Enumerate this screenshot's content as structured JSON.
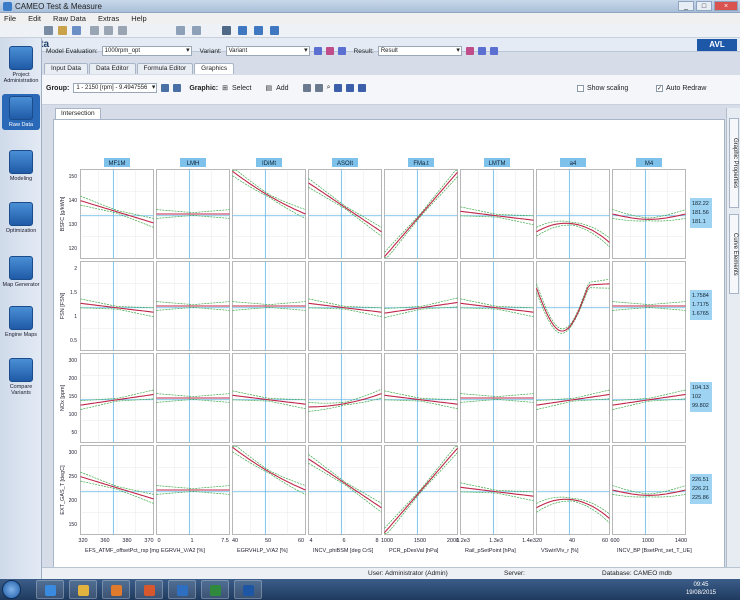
{
  "window": {
    "title": "CAMEO Test & Measure",
    "controls": [
      "_",
      "□",
      "×"
    ]
  },
  "menu": [
    "File",
    "Edit",
    "Raw Data",
    "Extras",
    "Help"
  ],
  "page": {
    "title": "Raw Data",
    "logo": "AVL"
  },
  "sidebar": [
    {
      "label": "Project Administration",
      "icon": "project-icon"
    },
    {
      "label": "Raw Data",
      "icon": "raw-data-icon",
      "active": true
    },
    {
      "label": "Modeling",
      "icon": "modeling-icon"
    },
    {
      "label": "Optimization",
      "icon": "optimization-icon"
    },
    {
      "label": "Map Generator",
      "icon": "map-generator-icon"
    },
    {
      "label": "Engine Maps",
      "icon": "engine-maps-icon"
    },
    {
      "label": "Compare Variants",
      "icon": "compare-icon"
    }
  ],
  "controls": {
    "model_evaluation_label": "Model Evaluation:",
    "model_evaluation_value": "1000rpm_opt",
    "variant_label": "Variant:",
    "variant_value": "Variant",
    "result_label": "Result:",
    "result_value": "Result"
  },
  "tabs": [
    "Input Data",
    "Data Editor",
    "Formula Editor",
    "Graphics"
  ],
  "active_tab": "Graphics",
  "graph_toolbar": {
    "group_label": "Group:",
    "group_value": "1 - 2150 [rpm] - 9.4947556",
    "graphic_label": "Graphic:",
    "select_label": "Select",
    "add_label": "Add",
    "show_scaling": "Show scaling",
    "auto_redraw": "Auto Redraw"
  },
  "subtab": "Intersection",
  "right_tabs": [
    "Graphic Properties",
    "Curve Elements"
  ],
  "chart_data": {
    "type": "line",
    "columns": [
      {
        "header": "MF1M",
        "xlabel": "EFS_ATMF_offsetPct_rsp [mg/Hub]",
        "ticks": [
          "320",
          "360",
          "380",
          "370"
        ],
        "current": 0.45
      },
      {
        "header": "LMH",
        "xlabel": "EGRVH_V/A2 [%]",
        "ticks": [
          "0",
          "1",
          "7.5"
        ],
        "current": 0.45
      },
      {
        "header": "IDiMt",
        "xlabel": "EGRVHLP_V/A2 [%]",
        "ticks": [
          "40",
          "50",
          "60"
        ],
        "current": 0.45
      },
      {
        "header": "ASOIt",
        "xlabel": "INCV_phiBSM [deg CrS]",
        "ticks": [
          "4",
          "6",
          "8"
        ],
        "current": 0.45
      },
      {
        "header": "FMa.t",
        "xlabel": "PCR_pDesVal [hPa]",
        "ticks": [
          "1000",
          "1500",
          "2000"
        ],
        "current": 0.45
      },
      {
        "header": "LMTM",
        "xlabel": "Rail_pSetPoint [hPa]",
        "ticks": [
          "1.2e3",
          "1.3e3",
          "1.4e3"
        ],
        "current": 0.45
      },
      {
        "header": "a4",
        "xlabel": "VSwirlVlv_r [%]",
        "ticks": [
          "20",
          "40",
          "60"
        ],
        "current": 0.45
      },
      {
        "header": "M4",
        "xlabel": "INCV_BP [BsetPnt_set_T_UE] [us]",
        "ticks": [
          "600",
          "1000",
          "1400"
        ],
        "current": 0.45
      }
    ],
    "rows": [
      {
        "ylabel": "BSFC [g/kWh]",
        "ticks": [
          "150",
          "140",
          "130",
          "120"
        ],
        "values": [
          "182.22",
          "181.56",
          "181.1"
        ]
      },
      {
        "ylabel": "FSN [FSN]",
        "ticks": [
          "2",
          "1.5",
          "1",
          "0.5"
        ],
        "values": [
          "1.7584",
          "1.7175",
          "1.6765"
        ]
      },
      {
        "ylabel": "NOx [ppm]",
        "ticks": [
          "300",
          "200",
          "150",
          "100",
          "50"
        ],
        "values": [
          "104.13",
          "102",
          "99.802"
        ]
      },
      {
        "ylabel": "EXT_GAS_T [degC]",
        "ticks": [
          "300",
          "250",
          "200",
          "150"
        ],
        "values": [
          "226.51",
          "226.21",
          "225.86"
        ]
      }
    ],
    "shapes": [
      [
        "decline",
        "flat",
        "steep_decline",
        "decline_curve",
        "steep_rise",
        "slight_decline",
        "dip",
        "flat_dip"
      ],
      [
        "slight_decline",
        "flat",
        "flat",
        "slight_decline",
        "slight_rise",
        "slight_decline",
        "deep_dip",
        "flat"
      ],
      [
        "slight_rise",
        "flat",
        "slight_decline",
        "rise_bump",
        "slight_decline",
        "flat",
        "slight_rise",
        "slight_rise"
      ],
      [
        "decline",
        "flat",
        "steep_decline",
        "decline_curve",
        "steep_rise",
        "slight_decline",
        "dip",
        "flat_dip"
      ]
    ]
  },
  "status": {
    "user": "User: Administrator (Admin)",
    "server": "Server:",
    "database": "Database: CAMEO mdb"
  },
  "taskbar": {
    "time": "09:45",
    "date": "19/08/2015"
  },
  "colors": {
    "accent": "#2a69b8",
    "model_line": "#c0274b",
    "band": "#3aa845",
    "cursor": "#5fb6e6"
  }
}
